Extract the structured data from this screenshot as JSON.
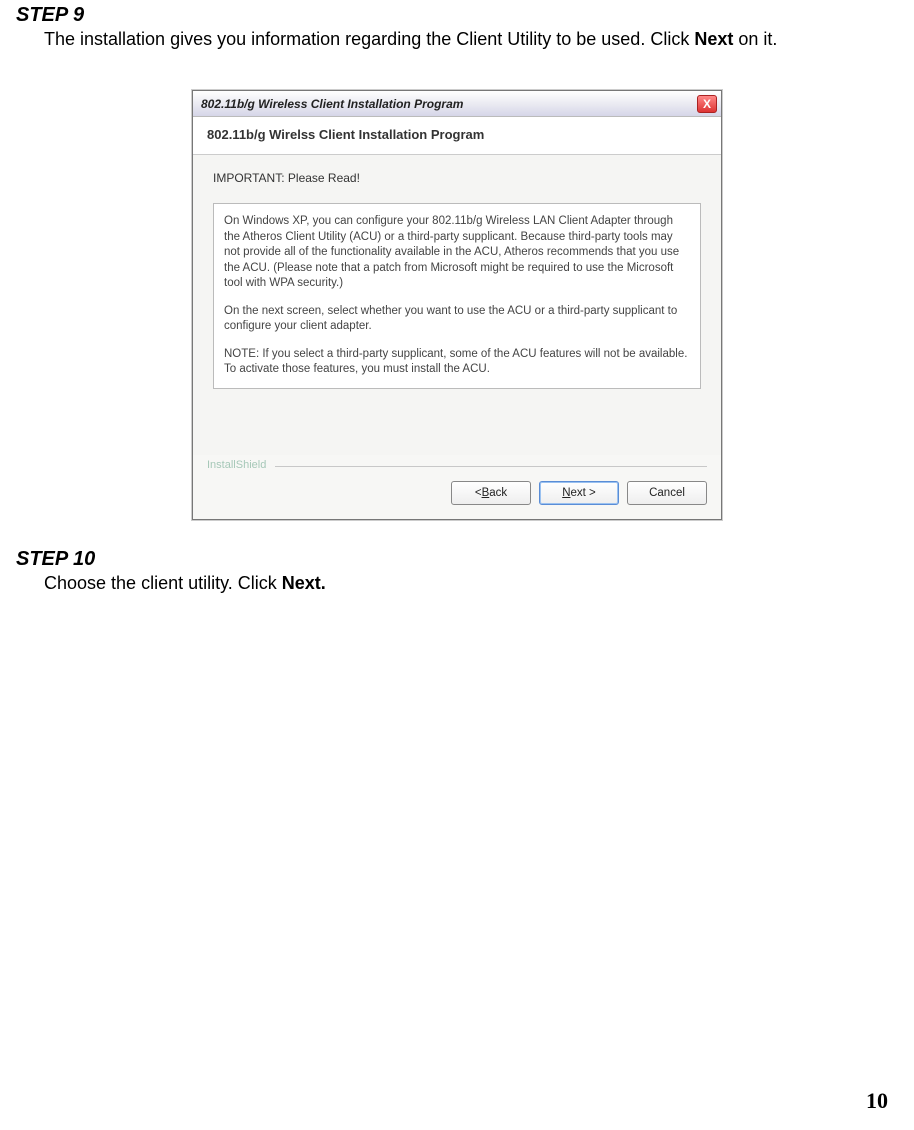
{
  "step9": {
    "heading": "STEP 9",
    "body_pre": "The installation gives you information regarding the Client Utility to be used. Click ",
    "body_bold": "Next",
    "body_post": " on it."
  },
  "installer": {
    "titlebar": "802.11b/g Wireless Client Installation Program",
    "close_icon": "X",
    "banner": "802.11b/g Wirelss Client Installation Program",
    "important_label": "IMPORTANT: Please Read!",
    "paragraph1": "On Windows XP, you can configure your 802.11b/g Wireless LAN Client Adapter through the Atheros Client Utility (ACU) or a third-party supplicant. Because third-party tools may not provide all of the functionality available in the ACU, Atheros recommends that you use the ACU. (Please note that a patch from Microsoft might be required to use the Microsoft tool with WPA security.)",
    "paragraph2": "On the next screen, select whether you want to use the ACU or a third-party supplicant to configure your client adapter.",
    "paragraph3": "NOTE: If you select a third-party supplicant, some of the ACU features will not be available. To activate those features, you must install the ACU.",
    "installshield_label": "InstallShield",
    "buttons": {
      "back_prefix": "< ",
      "back_u": "B",
      "back_rest": "ack",
      "next_u": "N",
      "next_rest": "ext >",
      "cancel": "Cancel"
    }
  },
  "step10": {
    "heading": "STEP 10",
    "body_pre": "Choose the client utility. Click ",
    "body_bold": "Next."
  },
  "page_number": "10"
}
